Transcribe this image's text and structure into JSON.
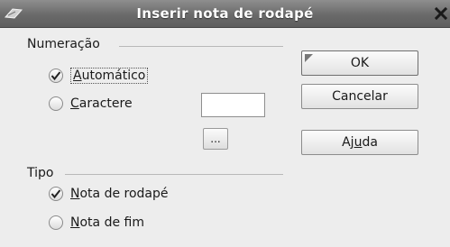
{
  "window": {
    "title": "Inserir nota de rodapé",
    "icon": "app-icon",
    "close_icon": "close-icon"
  },
  "numbering": {
    "label": "Numeração",
    "automatic": {
      "label_underlined": "A",
      "label_rest": "utomático",
      "selected": true
    },
    "character": {
      "label_underlined": "C",
      "label_rest": "aractere",
      "selected": false
    },
    "character_value": "",
    "browse_label": "..."
  },
  "type": {
    "label": "Tipo",
    "footnote": {
      "label_underlined": "N",
      "label_rest": "ota de rodapé",
      "selected": true
    },
    "endnote": {
      "label_underlined": "N",
      "label_rest": "ota de fim",
      "selected": false
    }
  },
  "buttons": {
    "ok": "OK",
    "cancel": "Cancelar",
    "help_prefix": "Aj",
    "help_underlined": "u",
    "help_suffix": "da"
  }
}
